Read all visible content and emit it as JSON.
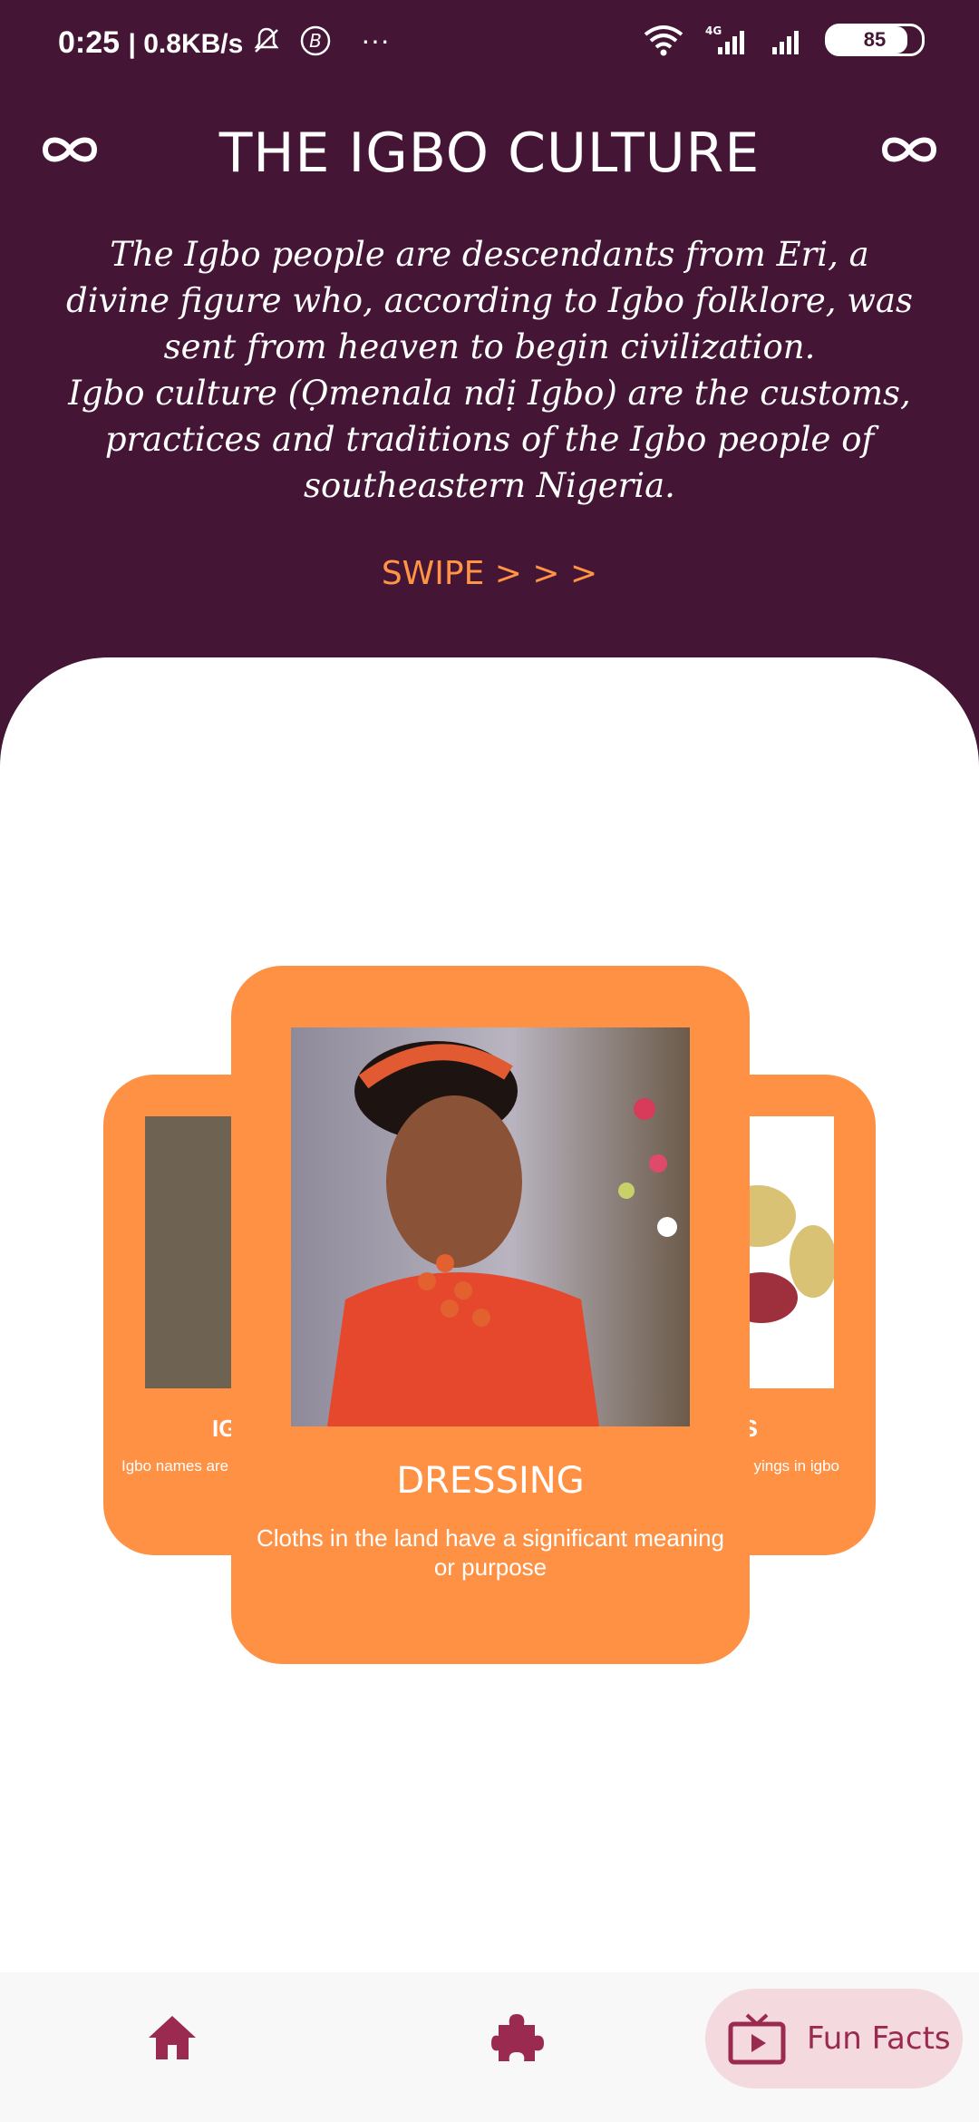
{
  "status_bar": {
    "time": "0:25",
    "net_speed": "| 0.8KB/s",
    "more_dots": "···",
    "battery": "85"
  },
  "header": {
    "title": "THE IGBO CULTURE",
    "left_icon": "infinity-icon",
    "right_icon": "infinity-icon"
  },
  "intro": {
    "paragraph1": "The Igbo people are descendants from Eri, a divine figure who, according to Igbo folklore, was sent from heaven to begin civilization.",
    "paragraph2": "Igbo culture (Ọmenala ndị Igbo) are the customs, practices and traditions of the Igbo people of southeastern Nigeria."
  },
  "swipe_hint": "SWIPE > > >",
  "carousel": {
    "left_card": {
      "title": "IG",
      "subtitle": "Igbo names are"
    },
    "main_card": {
      "title": "DRESSING",
      "subtitle": "Cloths in the land have a significant meaning or purpose"
    },
    "right_card": {
      "title": "S",
      "subtitle": "yings in igbo"
    }
  },
  "bottom_nav": {
    "home_icon": "home-icon",
    "puzzle_icon": "puzzle-icon",
    "fun_facts_label": "Fun Facts"
  },
  "colors": {
    "header_bg": "#451535",
    "card_bg": "#ff9145",
    "accent": "#ff9445",
    "nav_active": "#9b2a51"
  }
}
